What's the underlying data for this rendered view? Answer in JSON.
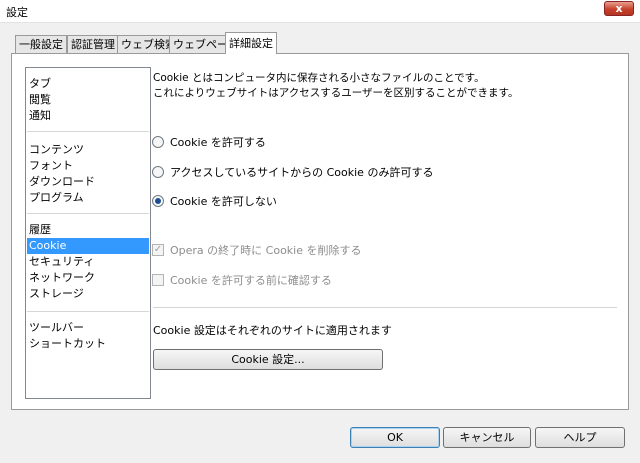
{
  "window": {
    "title": "設定",
    "close_glyph": "x"
  },
  "tabs": [
    {
      "label": "一般設定"
    },
    {
      "label": "認証管理"
    },
    {
      "label": "ウェブ検索"
    },
    {
      "label": "ウェブページ"
    },
    {
      "label": "詳細設定",
      "active": true
    }
  ],
  "categories": {
    "group1": [
      "タブ",
      "閲覧",
      "通知"
    ],
    "group2": [
      "コンテンツ",
      "フォント",
      "ダウンロード",
      "プログラム"
    ],
    "group3": [
      "履歴",
      "Cookie",
      "セキュリティ",
      "ネットワーク",
      "ストレージ"
    ],
    "group4": [
      "ツールバー",
      "ショートカット"
    ],
    "selected": "Cookie"
  },
  "cookie_page": {
    "description_line1": "Cookie とはコンピュータ内に保存される小さなファイルのことです。",
    "description_line2": "これによりウェブサイトはアクセスするユーザーを区別することができます。",
    "radio_options": [
      {
        "label": "Cookie を許可する",
        "checked": false
      },
      {
        "label": "アクセスしているサイトからの Cookie のみ許可する",
        "checked": false
      },
      {
        "label": "Cookie を許可しない",
        "checked": true
      }
    ],
    "checkboxes": [
      {
        "label": "Opera の終了時に Cookie を削除する",
        "checked": true,
        "enabled": false
      },
      {
        "label": "Cookie を許可する前に確認する",
        "checked": false,
        "enabled": false
      }
    ],
    "note": "Cookie 設定はそれぞれのサイトに適用されます",
    "settings_button": "Cookie 設定..."
  },
  "footer": {
    "ok": "OK",
    "cancel": "キャンセル",
    "help": "ヘルプ"
  },
  "colors": {
    "selection": "#3399ff",
    "close_button": "#c7412b",
    "radio_dot": "#1d4e93"
  }
}
